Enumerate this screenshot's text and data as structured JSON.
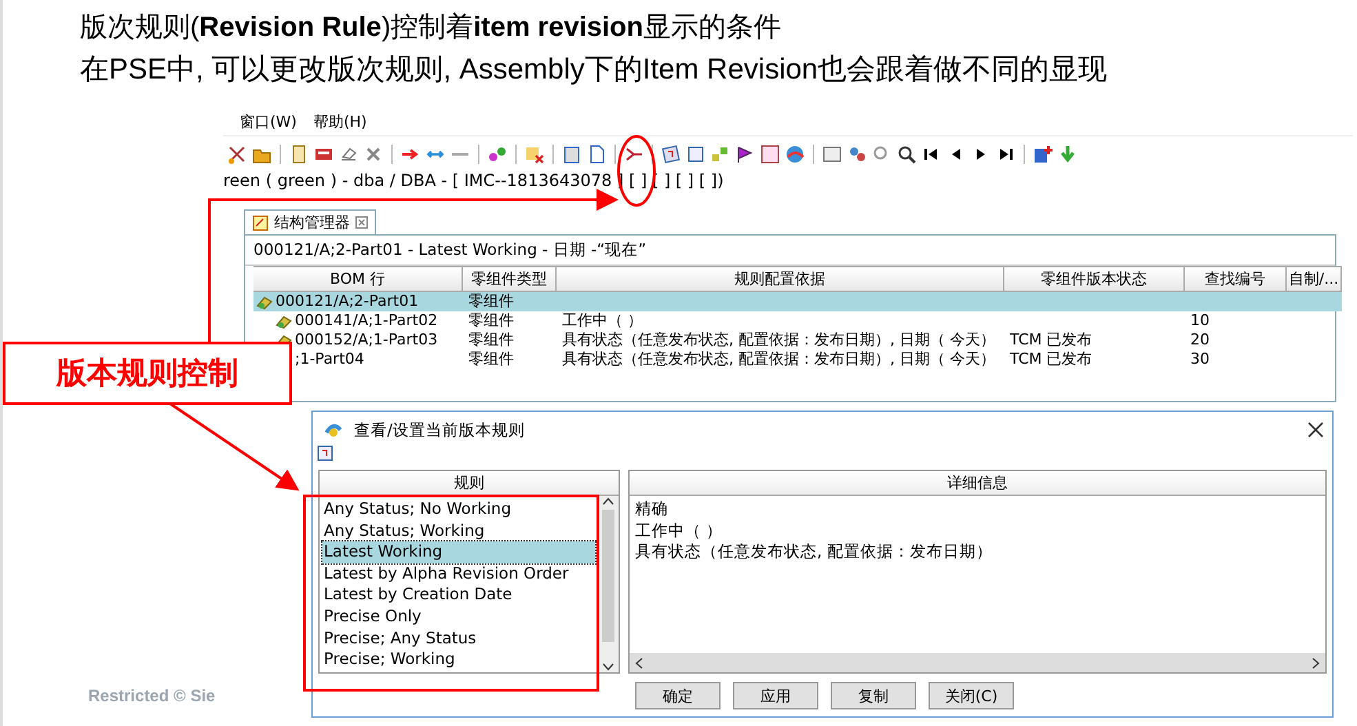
{
  "slide": {
    "title": "版次规则(**Revision Rule**)控制着**item revision**显示的条件",
    "subtitle": "在PSE中, 可以更改版次规则, Assembly下的Item Revision也会跟着做不同的显现",
    "footer": "Restricted © Sie"
  },
  "menu": [
    {
      "label": "窗口(W)"
    },
    {
      "label": "帮助(H)"
    }
  ],
  "context_path": "reen ( green ) - dba / DBA - [ IMC--1813643078 ] [ ] [ ] [ ] [ ])",
  "tabs": [
    {
      "label": "结构管理器",
      "selected": true
    }
  ],
  "structure": {
    "header": "000121/A;2-Part01 - Latest Working - 日期 -“现在”",
    "columns": [
      "BOM 行",
      "零组件类型",
      "规则配置依据",
      "零组件版本状态",
      "查找编号",
      "自制/..."
    ],
    "rows": [
      {
        "bom_line": "000121/A;2-Part01",
        "type": "零组件",
        "selected": true,
        "children": [
          {
            "bom_line": "000141/A;1-Part02",
            "type": "零组件",
            "rule_basis": "工作中（ ）",
            "find_no": "10",
            "selected": false
          },
          {
            "bom_line": "000152/A;1-Part03",
            "type": "零组件",
            "rule_basis": "具有状态（任意发布状态, 配置依据：发布日期）, 日期（ 今天）",
            "status": "TCM 已发布",
            "find_no": "20",
            "selected": false
          },
          {
            "bom_line": ";1-Part04",
            "type": "零组件",
            "rule_basis": "具有状态（任意发布状态, 配置依据：发布日期）, 日期（ 今天）",
            "status": "TCM 已发布",
            "find_no": "30",
            "selected": false
          }
        ]
      }
    ]
  },
  "callout": {
    "text": "版本规则控制"
  },
  "dialog": {
    "title": "查看/设置当前版本规则",
    "rules_header": "规则",
    "details_header": "详细信息",
    "rules": [
      {
        "label": "Any Status; No Working",
        "selected": false
      },
      {
        "label": "Any Status; Working",
        "selected": false
      },
      {
        "label": "Latest Working",
        "selected": true
      },
      {
        "label": "Latest by Alpha Revision Order",
        "selected": false
      },
      {
        "label": "Latest by Creation Date",
        "selected": false
      },
      {
        "label": "Precise Only",
        "selected": false
      },
      {
        "label": "Precise; Any Status",
        "selected": false
      },
      {
        "label": "Precise; Working",
        "selected": false
      }
    ],
    "details": [
      "精确",
      "工作中（ ）",
      "具有状态（任意发布状态, 配置依据：发布日期）"
    ],
    "buttons": [
      "确定",
      "应用",
      "复制",
      "关闭(C)"
    ]
  }
}
